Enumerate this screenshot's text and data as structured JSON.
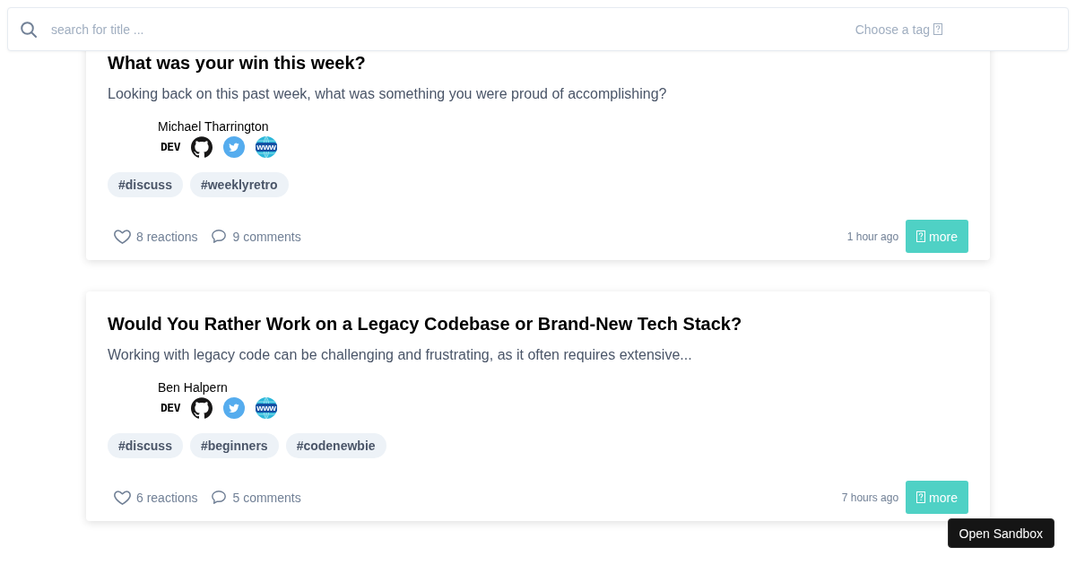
{
  "search_bar": {
    "placeholder": "search for title ...",
    "tag_select": {
      "placeholder": "Choose a tag"
    }
  },
  "posts": [
    {
      "title": "What was your win this week?",
      "description": "Looking back on this past week, what was something you were proud of accomplishing?",
      "author": {
        "name": "Michael Tharrington",
        "links": [
          {
            "kind": "dev",
            "label": "DEV"
          },
          {
            "kind": "github"
          },
          {
            "kind": "twitter"
          },
          {
            "kind": "website",
            "label": "www"
          }
        ]
      },
      "tags": [
        "#discuss",
        "#weeklyretro"
      ],
      "reactions": "8 reactions",
      "comments": "9 comments",
      "time": "1 hour ago",
      "more_button": {
        "label": "more"
      }
    },
    {
      "title": "Would You Rather Work on a Legacy Codebase or Brand-New Tech Stack?",
      "description": "Working with legacy code can be challenging and frustrating, as it often requires extensive...",
      "author": {
        "name": "Ben Halpern",
        "links": [
          {
            "kind": "dev",
            "label": "DEV"
          },
          {
            "kind": "github"
          },
          {
            "kind": "twitter"
          },
          {
            "kind": "website",
            "label": "www"
          }
        ]
      },
      "tags": [
        "#discuss",
        "#beginners",
        "#codenewbie"
      ],
      "reactions": "6 reactions",
      "comments": "5 comments",
      "time": "7 hours ago",
      "more_button": {
        "label": "more"
      }
    }
  ],
  "sandbox_button": {
    "label": "Open Sandbox"
  }
}
